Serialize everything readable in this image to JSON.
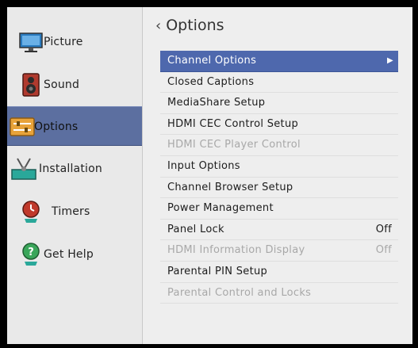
{
  "sidebar": {
    "items": [
      {
        "label": "Picture",
        "icon": "monitor-icon"
      },
      {
        "label": "Sound",
        "icon": "speaker-icon"
      },
      {
        "label": "Options",
        "icon": "options-sliders-icon",
        "active": true
      },
      {
        "label": "Installation",
        "icon": "satellite-antenna-icon"
      },
      {
        "label": "Timers",
        "icon": "timer-icon"
      },
      {
        "label": "Get Help",
        "icon": "help-icon"
      }
    ]
  },
  "main": {
    "back_glyph": "‹",
    "title": "Options",
    "rows": [
      {
        "label": "Channel Options",
        "value": "",
        "arrow": "▶"
      },
      {
        "label": "Closed Captions",
        "value": ""
      },
      {
        "label": "MediaShare Setup",
        "value": ""
      },
      {
        "label": "HDMI CEC Control Setup",
        "value": ""
      },
      {
        "label": "HDMI CEC Player Control",
        "value": ""
      },
      {
        "label": "Input Options",
        "value": ""
      },
      {
        "label": "Channel Browser Setup",
        "value": ""
      },
      {
        "label": "Power Management",
        "value": ""
      },
      {
        "label": "Panel Lock",
        "value": "Off"
      },
      {
        "label": "HDMI Information Display",
        "value": "Off"
      },
      {
        "label": "Parental PIN Setup",
        "value": ""
      },
      {
        "label": "Parental Control and Locks",
        "value": ""
      }
    ]
  },
  "colors": {
    "selection": "#4e68ad",
    "sidebar_active": "#5c6fa0",
    "disabled_text": "#a8a8a8"
  }
}
